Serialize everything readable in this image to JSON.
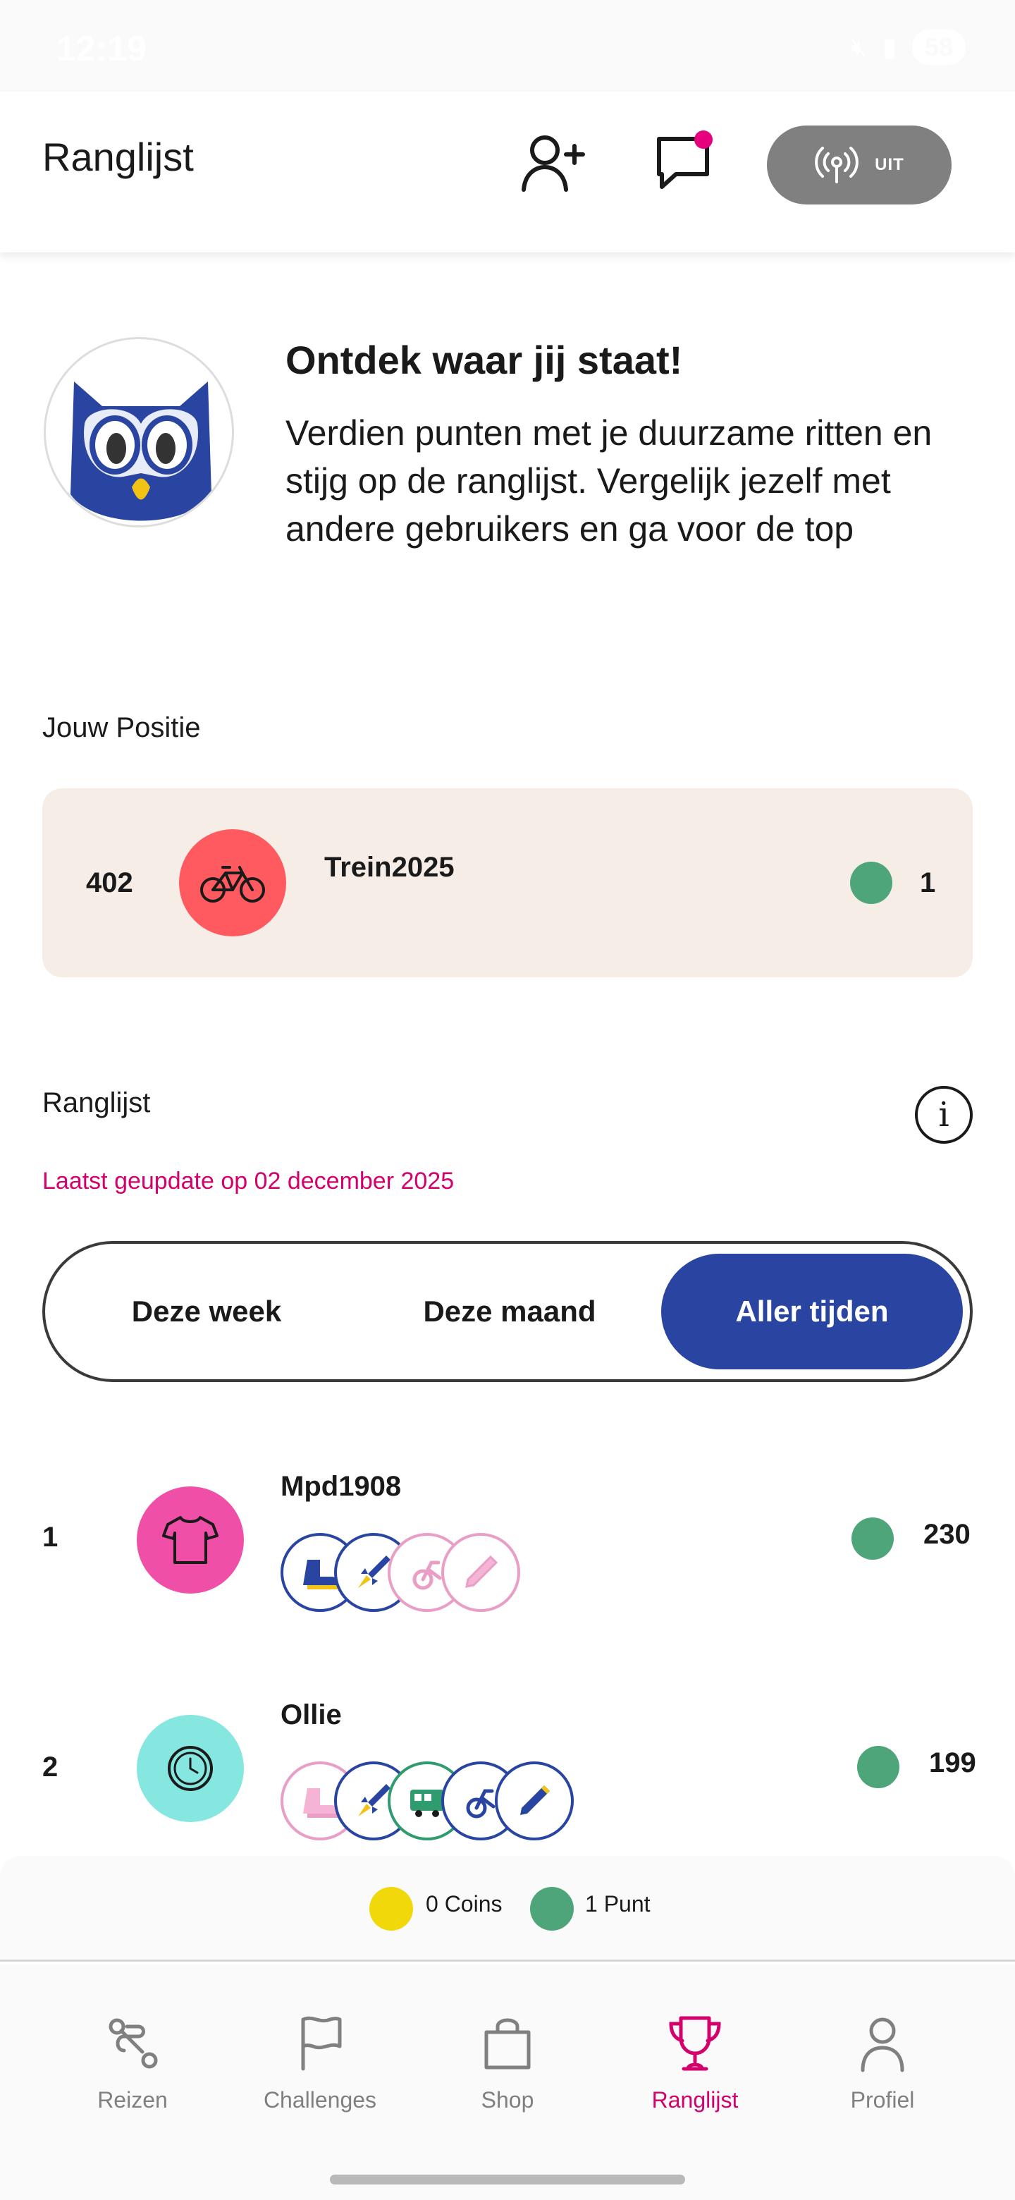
{
  "status_bar": {
    "time": "12:19",
    "battery": "58"
  },
  "header": {
    "title": "Ranglijst",
    "toggle_label": "UIT"
  },
  "intro": {
    "title": "Ontdek waar jij staat!",
    "text": "Verdien punten met je duurzame ritten en stijg op de ranglijst. Vergelijk jezelf met andere gebruikers en ga voor de top"
  },
  "my_position": {
    "section_label": "Jouw Positie",
    "rank": "402",
    "username": "Trein2025",
    "points": "1",
    "avatar_icon": "bicycle-icon",
    "avatar_color": "#ff5a5f"
  },
  "leaderboard": {
    "section_label": "Ranglijst",
    "updated": "Laatst geupdate op 02 december 2025",
    "tabs": [
      {
        "label": "Deze week",
        "active": false
      },
      {
        "label": "Deze maand",
        "active": false
      },
      {
        "label": "Aller tijden",
        "active": true
      }
    ],
    "rows": [
      {
        "rank": "1",
        "username": "Mpd1908",
        "points": "230",
        "avatar_icon": "tshirt-icon",
        "avatar_color": "#ef4fa6",
        "badges": [
          "boot-icon",
          "rocket-icon",
          "bike-icon",
          "pencil-icon"
        ]
      },
      {
        "rank": "2",
        "username": "Ollie",
        "points": "199",
        "avatar_icon": "clock-icon",
        "avatar_color": "#86e6e0",
        "badges": [
          "boot-icon",
          "rocket-icon",
          "train-icon",
          "bike-icon",
          "pencil-icon"
        ]
      }
    ]
  },
  "totals": {
    "coins": "0 Coins",
    "points": "1 Punt",
    "coin_color": "#f0d80a",
    "point_color": "#4fa57a"
  },
  "nav": [
    {
      "label": "Reizen",
      "icon": "route-icon",
      "active": false
    },
    {
      "label": "Challenges",
      "icon": "flag-icon",
      "active": false
    },
    {
      "label": "Shop",
      "icon": "shopping-bag-icon",
      "active": false
    },
    {
      "label": "Ranglijst",
      "icon": "trophy-icon",
      "active": true
    },
    {
      "label": "Profiel",
      "icon": "user-icon",
      "active": false
    }
  ],
  "colors": {
    "accent": "#d4006b",
    "primary": "#2a45a1",
    "card": "#f6ede7"
  }
}
